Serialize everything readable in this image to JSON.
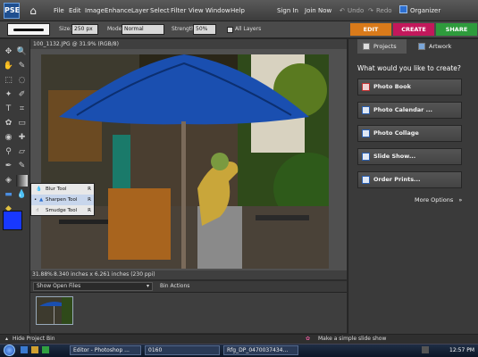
{
  "app": {
    "logo_text": "PSE"
  },
  "menu": [
    "File",
    "Edit",
    "Image",
    "Enhance",
    "Layer",
    "Select",
    "Filter",
    "View",
    "Window",
    "Help"
  ],
  "account": {
    "sign_in": "Sign In",
    "join_now": "Join Now"
  },
  "history": {
    "undo": "Undo",
    "redo": "Redo",
    "organizer": "Organizer"
  },
  "options": {
    "size_label": "Size:",
    "size_value": "250 px",
    "mode_label": "Mode:",
    "mode_value": "Normal",
    "strength_label": "Strength:",
    "strength_value": "50%",
    "all_layers": "All Layers"
  },
  "mode_tabs": {
    "edit": "EDIT",
    "create": "CREATE",
    "share": "SHARE"
  },
  "document": {
    "title": "100_1132.JPG @ 31.9% (RGB/8)",
    "zoom": "31.88%",
    "doc_size": "8.340 inches x 6.261 inches (230 ppi)"
  },
  "flyout": {
    "items": [
      {
        "label": "Blur Tool",
        "key": "R"
      },
      {
        "label": "Sharpen Tool",
        "key": "R"
      },
      {
        "label": "Smudge Tool",
        "key": "R"
      }
    ]
  },
  "bin": {
    "show_select": "Show Open Files",
    "actions": "Bin Actions",
    "hide": "Hide Project Bin"
  },
  "right_panel": {
    "tabs": {
      "projects": "Projects",
      "artwork": "Artwork"
    },
    "heading": "What would you like to create?",
    "buttons": [
      "Photo Book",
      "Photo Calendar ...",
      "Photo Collage",
      "Slide Show...",
      "Order Prints..."
    ],
    "more": "More Options"
  },
  "hint": "Make a simple slide show",
  "taskbar": {
    "items": [
      "Editor - Photoshop ...",
      "0160",
      "Rfg_DP_0470037434..."
    ],
    "clock": "12:57 PM"
  },
  "colors": {
    "edit_tab": "#d97a1a",
    "create_tab": "#c2185b",
    "share_tab": "#2e9b3c",
    "foreground": "#1838ff",
    "background": "#ffffff"
  }
}
